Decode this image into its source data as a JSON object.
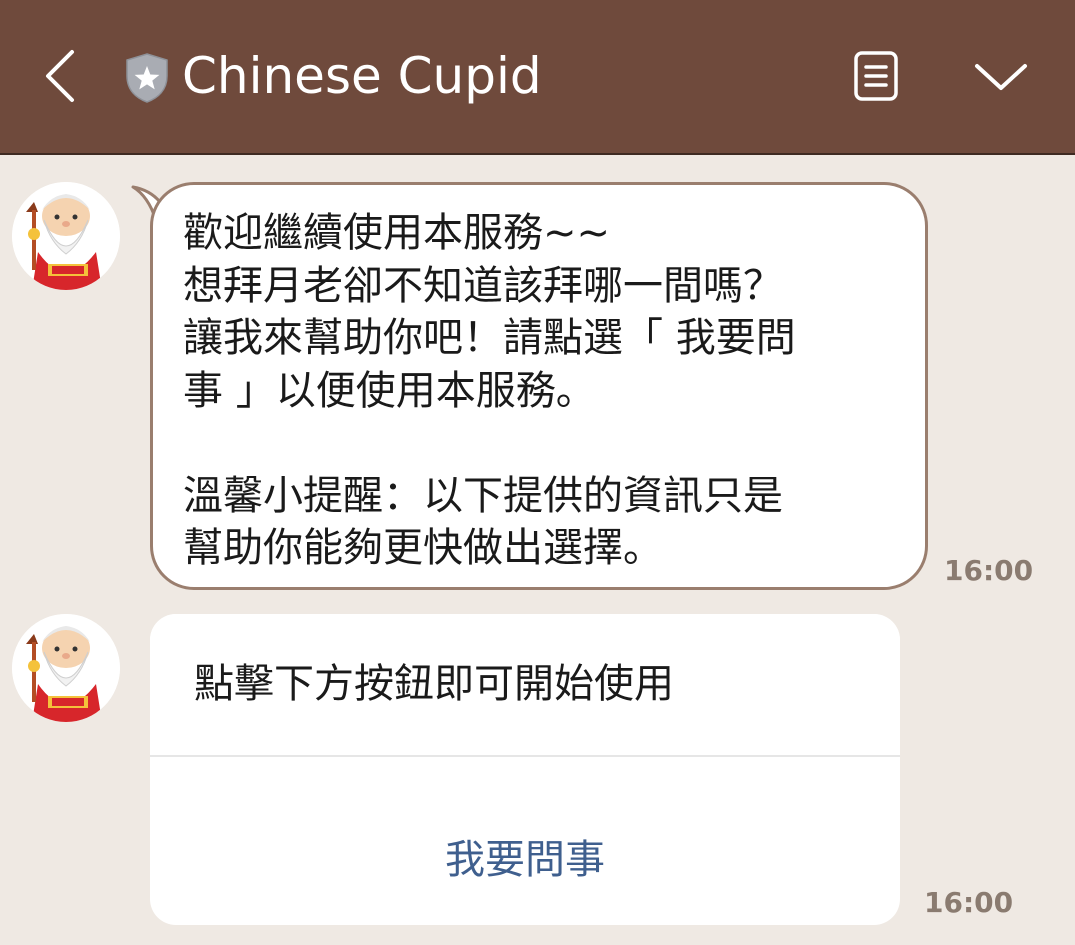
{
  "header": {
    "title": "Chinese Cupid",
    "colors": {
      "background": "#6f4a3c",
      "title": "#ffffff"
    },
    "icons": {
      "back": "chevron-left-icon",
      "verified": "shield-star-icon",
      "notes": "note-list-icon",
      "menu": "chevron-down-icon"
    }
  },
  "messages": [
    {
      "sender_icon": "old-man-avatar-icon",
      "lines": [
        "歡迎繼續使用本服務~~",
        "想拜月老卻不知道該拜哪一間嗎？",
        "讓我來幫助你吧！請點選「 我要問",
        "事 」以便使用本服務。",
        "",
        "溫馨小提醒：以下提供的資訊只是",
        "幫助你能夠更快做出選擇。"
      ],
      "time": "16:00"
    },
    {
      "sender_icon": "old-man-avatar-icon",
      "card": {
        "text": "點擊下方按鈕即可開始使用",
        "button_label": "我要問事",
        "button_color": "#3f5f8e"
      },
      "time": "16:00"
    }
  ],
  "partial_time_top": "16:00",
  "colors": {
    "chat_background": "#efe9e3",
    "bubble_border": "#9a7e6e",
    "time": "#8a7b70"
  }
}
